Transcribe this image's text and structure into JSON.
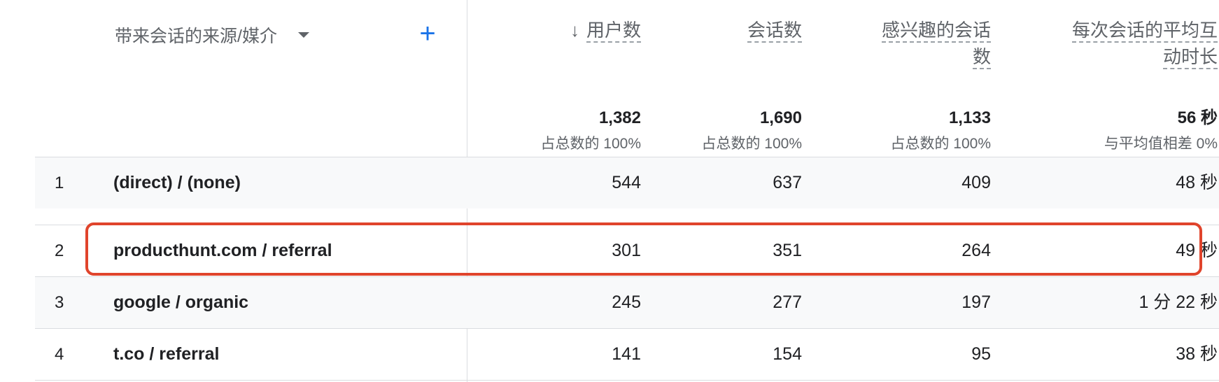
{
  "dimension": {
    "label": "带来会话的来源/媒介",
    "add_label": "+"
  },
  "metrics": [
    {
      "key": "users",
      "label": "用户数",
      "label_lines": [
        "用户数"
      ],
      "sorted": true,
      "sort_icon": "↓"
    },
    {
      "key": "sessions",
      "label": "会话数",
      "label_lines": [
        "会话数"
      ]
    },
    {
      "key": "engaged",
      "label": "感兴趣的会话数",
      "label_lines": [
        "感兴趣的会话",
        "数"
      ]
    },
    {
      "key": "avg_time",
      "label": "每次会话的平均互动时长",
      "label_lines": [
        "每次会话的平均互",
        "动时长"
      ]
    }
  ],
  "totals": [
    {
      "value": "1,382",
      "note": "占总数的 100%"
    },
    {
      "value": "1,690",
      "note": "占总数的 100%"
    },
    {
      "value": "1,133",
      "note": "占总数的 100%"
    },
    {
      "value": "56 秒",
      "note": "与平均值相差 0%"
    }
  ],
  "rows": [
    {
      "index": "1",
      "source": "(direct) / (none)",
      "users": "544",
      "sessions": "637",
      "engaged": "409",
      "avg_time": "48 秒"
    },
    {
      "index": "2",
      "source": "producthunt.com / referral",
      "users": "301",
      "sessions": "351",
      "engaged": "264",
      "avg_time": "49 秒"
    },
    {
      "index": "3",
      "source": "google / organic",
      "users": "245",
      "sessions": "277",
      "engaged": "197",
      "avg_time": "1 分 22 秒"
    },
    {
      "index": "4",
      "source": "t.co / referral",
      "users": "141",
      "sessions": "154",
      "engaged": "95",
      "avg_time": "38 秒"
    }
  ],
  "highlight_color": "#e0442c",
  "accent_color": "#1a73e8"
}
